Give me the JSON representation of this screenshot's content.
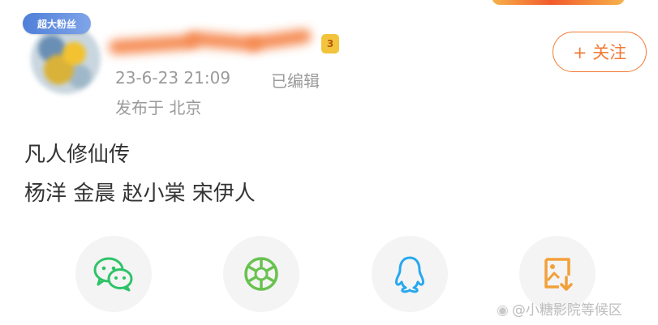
{
  "profile": {
    "badge_label": "超大粉丝",
    "level_label": "3"
  },
  "post": {
    "timestamp": "23-6-23 21:09",
    "edited_label": "已编辑",
    "location": "发布于 北京",
    "lines": [
      "凡人修仙传",
      "杨洋 金晨 赵小棠 宋伊人"
    ]
  },
  "follow_button": {
    "label": "+ 关注"
  },
  "share_icons": [
    "wechat-icon",
    "moments-icon",
    "qq-icon",
    "save-image-icon"
  ],
  "watermark": "@小糖影院等候区",
  "colors": {
    "accent": "#f27a35",
    "meta_text": "#9a9a9a",
    "body_text": "#333333",
    "wechat": "#2ec367",
    "moments": "#68c24f",
    "qq": "#27a8ee",
    "save": "#f2a03a"
  }
}
